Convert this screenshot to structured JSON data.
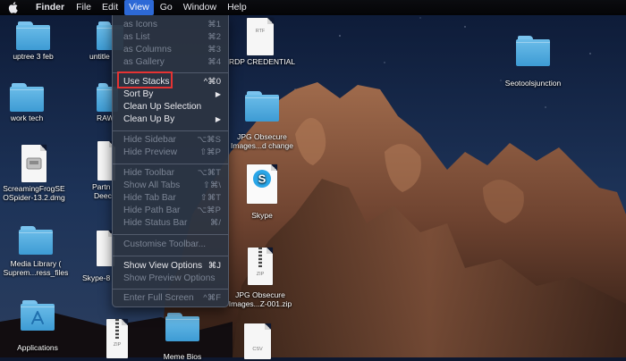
{
  "menubar": {
    "app_name": "Finder",
    "items": [
      "File",
      "Edit",
      "View",
      "Go",
      "Window",
      "Help"
    ],
    "active_item": "View"
  },
  "view_menu": {
    "items": [
      {
        "label": "as Icons",
        "shortcut": "⌘1",
        "enabled": false
      },
      {
        "label": "as List",
        "shortcut": "⌘2",
        "enabled": false
      },
      {
        "label": "as Columns",
        "shortcut": "⌘3",
        "enabled": false
      },
      {
        "label": "as Gallery",
        "shortcut": "⌘4",
        "enabled": false
      },
      {
        "label": "Use Stacks",
        "shortcut": "^⌘0",
        "enabled": true
      },
      {
        "label": "Sort By",
        "shortcut": "▶",
        "enabled": true
      },
      {
        "label": "Clean Up Selection",
        "shortcut": "",
        "enabled": true
      },
      {
        "label": "Clean Up By",
        "shortcut": "▶",
        "enabled": true
      },
      {
        "label": "Hide Sidebar",
        "shortcut": "⌥⌘S",
        "enabled": false
      },
      {
        "label": "Hide Preview",
        "shortcut": "⇧⌘P",
        "enabled": false
      },
      {
        "label": "Hide Toolbar",
        "shortcut": "⌥⌘T",
        "enabled": false
      },
      {
        "label": "Show All Tabs",
        "shortcut": "⇧⌘\\",
        "enabled": false
      },
      {
        "label": "Hide Tab Bar",
        "shortcut": "⇧⌘T",
        "enabled": false
      },
      {
        "label": "Hide Path Bar",
        "shortcut": "⌥⌘P",
        "enabled": false
      },
      {
        "label": "Hide Status Bar",
        "shortcut": "⌘/",
        "enabled": false
      },
      {
        "label": "Customise Toolbar...",
        "shortcut": "",
        "enabled": false
      },
      {
        "label": "Show View Options",
        "shortcut": "⌘J",
        "enabled": true
      },
      {
        "label": "Show Preview Options",
        "shortcut": "",
        "enabled": false
      },
      {
        "label": "Enter Full Screen",
        "shortcut": "^⌘F",
        "enabled": false
      }
    ]
  },
  "desktop": {
    "icons": [
      {
        "label": "uptree 3 feb",
        "kind": "folder"
      },
      {
        "label": "untitle",
        "kind": "folder"
      },
      {
        "label": "work tech",
        "kind": "folder"
      },
      {
        "label": "RAW",
        "kind": "folder"
      },
      {
        "label": "ScreamingFrogSE",
        "label2": "OSpider-13.2.dmg",
        "kind": "dmg"
      },
      {
        "label": "Partn",
        "label2": "Deec",
        "kind": "doc"
      },
      {
        "label": "Media Library (",
        "label2": "Suprem...ress_files",
        "kind": "folder"
      },
      {
        "label": "Skype-8",
        "kind": "doc"
      },
      {
        "label": "Applications",
        "kind": "app-folder"
      },
      {
        "label": "Meme Bios",
        "kind": "folder"
      },
      {
        "label": "RDP CREDENTIAL",
        "kind": "doc",
        "ext": "RTF"
      },
      {
        "label": "JPG Obsecure",
        "label2": "Images...d change",
        "kind": "folder"
      },
      {
        "label": "Skype",
        "kind": "app"
      },
      {
        "label": "JPG Obsecure",
        "label2": "Images...Z-001.zip",
        "kind": "zip",
        "ext": "ZIP"
      },
      {
        "label": "",
        "kind": "doc",
        "ext": "CSV"
      },
      {
        "label": "",
        "kind": "zip",
        "ext": "ZIP"
      },
      {
        "label": "Seotoolsjunction",
        "kind": "folder"
      }
    ]
  },
  "colors": {
    "menu_highlight": "#2d69d6",
    "annotation_box": "#e53333",
    "folder_blue": "#4aa7de"
  }
}
